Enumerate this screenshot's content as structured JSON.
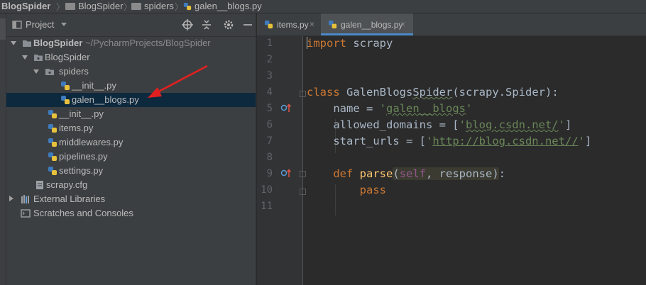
{
  "breadcrumb": {
    "items": [
      "BlogSpider",
      "BlogSpider",
      "spiders",
      "galen__blogs.py"
    ]
  },
  "project_panel": {
    "title": "Project",
    "tree": [
      {
        "name": "BlogSpider",
        "path": "~/PycharmProjects/BlogSpider",
        "type": "root-folder",
        "expanded": true
      },
      {
        "name": "BlogSpider",
        "type": "package",
        "expanded": true
      },
      {
        "name": "spiders",
        "type": "package",
        "expanded": true
      },
      {
        "name": "__init__.py",
        "type": "python-file"
      },
      {
        "name": "galen__blogs.py",
        "type": "python-file",
        "selected": true
      },
      {
        "name": "__init__.py",
        "type": "python-file"
      },
      {
        "name": "items.py",
        "type": "python-file"
      },
      {
        "name": "middlewares.py",
        "type": "python-file"
      },
      {
        "name": "pipelines.py",
        "type": "python-file"
      },
      {
        "name": "settings.py",
        "type": "python-file"
      },
      {
        "name": "scrapy.cfg",
        "type": "config-file"
      },
      {
        "name": "External Libraries",
        "type": "libraries",
        "expanded": false
      },
      {
        "name": "Scratches and Consoles",
        "type": "scratches"
      }
    ]
  },
  "editor": {
    "tabs": [
      {
        "label": "items.py",
        "active": false
      },
      {
        "label": "galen__blogs.py",
        "active": true
      }
    ],
    "line_numbers": [
      "1",
      "2",
      "3",
      "4",
      "5",
      "6",
      "7",
      "8",
      "9",
      "10",
      "11"
    ],
    "code": {
      "l1_kw": "import",
      "l1_rest": " scrapy",
      "l4_kw": "class",
      "l4_sp": " ",
      "l4_name_a": "GalenBlogs",
      "l4_name_b": "Spider",
      "l4_rest": "(scrapy.Spider):",
      "l5_a": "    name = ",
      "l5_q1": "'",
      "l5_s": "galen__blogs",
      "l5_q2": "'",
      "l6_a": "    allowed_domains = [",
      "l6_q1": "'",
      "l6_s": "blog.csdn.net/",
      "l6_q2": "'",
      "l6_b": "]",
      "l7_a": "    start_urls = [",
      "l7_q1": "'",
      "l7_s": "http://blog.csdn.net//",
      "l7_q2": "'",
      "l7_b": "]",
      "l9_ind": "    ",
      "l9_kw": "def",
      "l9_sp": " ",
      "l9_fn": "parse",
      "l9_p1": "(",
      "l9_self": "self",
      "l9_p2": ", response)",
      "l9_end": ":",
      "l10_ind": "        ",
      "l10_kw": "pass"
    }
  },
  "colors": {
    "panel_bg": "#3c3f41",
    "editor_bg": "#2b2b2b",
    "selection": "#0d293e",
    "keyword": "#cc7832",
    "string": "#6a8759",
    "function": "#ffc66d",
    "self": "#94558d",
    "annotation_arrow": "#e02020"
  },
  "icons": [
    "folder-icon",
    "python-file-icon",
    "config-file-icon",
    "libraries-icon",
    "scratches-icon",
    "locate-icon",
    "collapse-icon",
    "gear-icon",
    "minimize-icon",
    "override-method-icon",
    "fold-icon",
    "close-tab-icon",
    "red-arrow-annotation"
  ]
}
